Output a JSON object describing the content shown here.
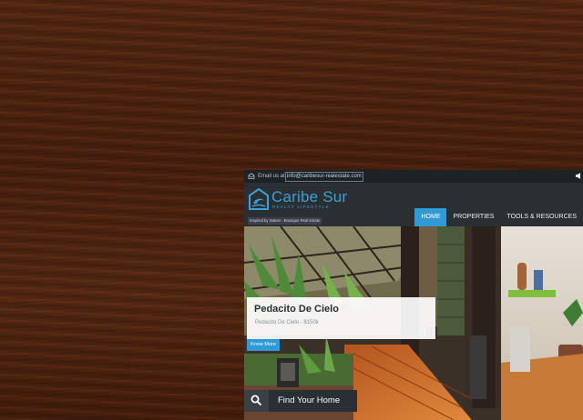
{
  "topbar": {
    "email_prefix": "Email us at :",
    "email": "info@caribesur-realestate.com",
    "mail_icon": "envelope-icon",
    "volume_icon": "speaker-icon"
  },
  "brand": {
    "name": "Caribe Sur",
    "sub": "REALTY LIFESTYLE",
    "tagline": "Inspired by Nature - Boutique Real Estate",
    "accent": "#3ba1d4"
  },
  "nav": {
    "items": [
      {
        "label": "HOME",
        "active": true
      },
      {
        "label": "PROPERTIES",
        "active": false
      },
      {
        "label": "TOOLS & RESOURCES",
        "active": false
      }
    ],
    "active_color": "#2f9bd6"
  },
  "hero": {
    "title": "Pedacito De Cielo",
    "subtitle": "Pedacito De Cielo - $150k",
    "cta": "Know More"
  },
  "search": {
    "label": "Find Your Home",
    "icon": "search-icon"
  }
}
